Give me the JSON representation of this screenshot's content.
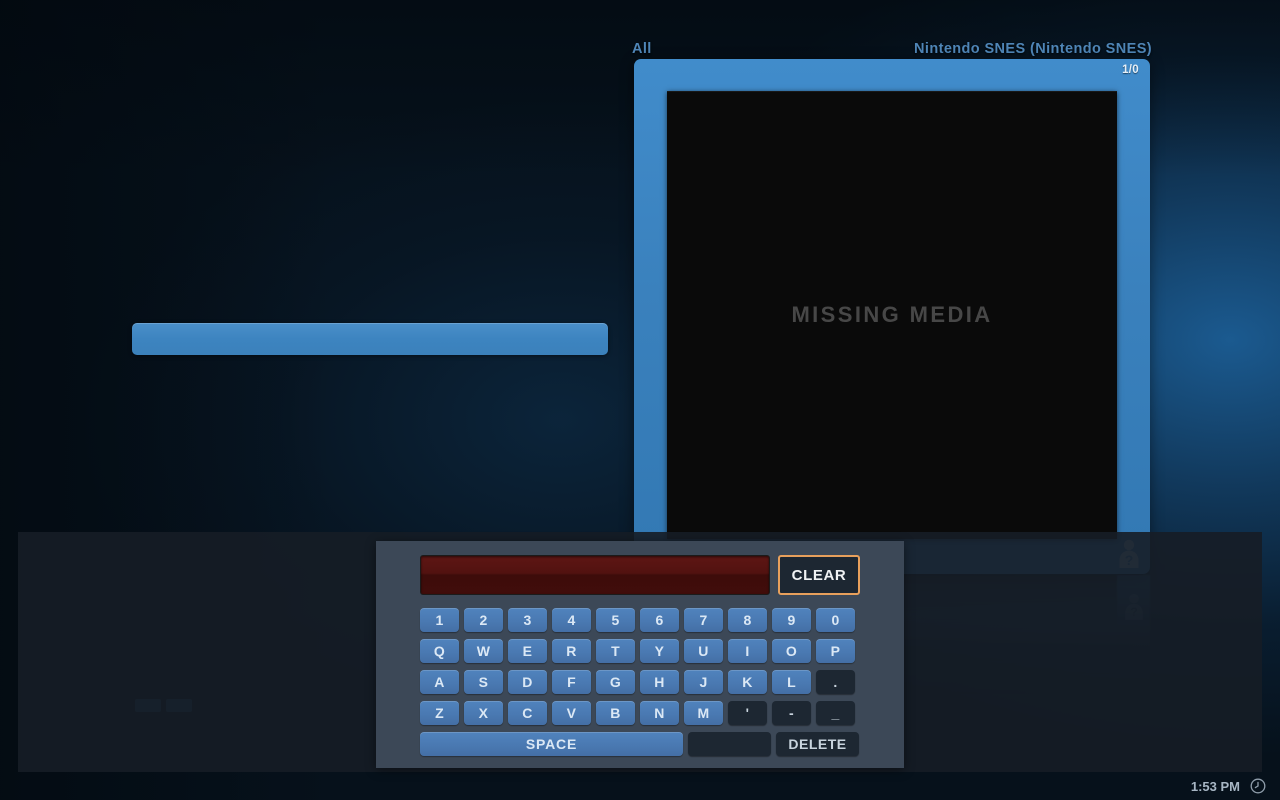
{
  "background": {
    "accent_blue": "#3a81bd",
    "base": "#06111b",
    "glow": "#1c5e96"
  },
  "header": {
    "filter_label": "All",
    "system_label": "Nintendo SNES (Nintendo SNES)"
  },
  "card": {
    "counter": "1/0",
    "art_placeholder": "MISSING MEDIA",
    "players_badge_icon": "person-question-icon"
  },
  "keyboard": {
    "input_value": "",
    "input_placeholder": "",
    "clear_label": "CLEAR",
    "focus_color": "#e8a05c",
    "key_color": "#4a79b2",
    "rows": [
      [
        "1",
        "2",
        "3",
        "4",
        "5",
        "6",
        "7",
        "8",
        "9",
        "0"
      ],
      [
        "Q",
        "W",
        "E",
        "R",
        "T",
        "Y",
        "U",
        "I",
        "O",
        "P"
      ],
      [
        "A",
        "S",
        "D",
        "F",
        "G",
        "H",
        "J",
        "K",
        "L",
        "."
      ],
      [
        "Z",
        "X",
        "C",
        "V",
        "B",
        "N",
        "M",
        "'",
        "-",
        "_"
      ]
    ],
    "dark_keys": [
      ".",
      "'",
      "-",
      "_"
    ],
    "space_label": "SPACE",
    "blank_label": "",
    "delete_label": "DELETE"
  },
  "status_bar": {
    "time": "1:53 PM",
    "clock_icon": "clock-icon"
  }
}
